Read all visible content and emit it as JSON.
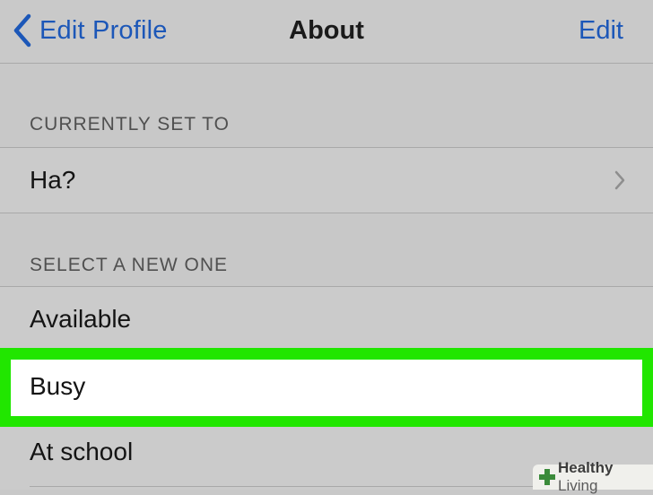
{
  "nav": {
    "back_label": "Edit Profile",
    "title": "About",
    "edit_label": "Edit"
  },
  "sections": {
    "current": {
      "header": "CURRENTLY SET TO",
      "value": "Ha?"
    },
    "new": {
      "header": "SELECT A NEW ONE",
      "options": [
        "Available",
        "Busy",
        "At school"
      ]
    }
  },
  "selected_option": "Busy",
  "watermark": {
    "brand_bold": "Healthy",
    "brand_light": " Living"
  },
  "colors": {
    "accent_blue": "#1c57b8",
    "highlight_green": "#21e600",
    "background_gray": "#c8c8c8"
  },
  "icons": {
    "back": "chevron-left-icon",
    "disclosure": "chevron-right-icon",
    "watermark": "cross-logo-icon"
  }
}
